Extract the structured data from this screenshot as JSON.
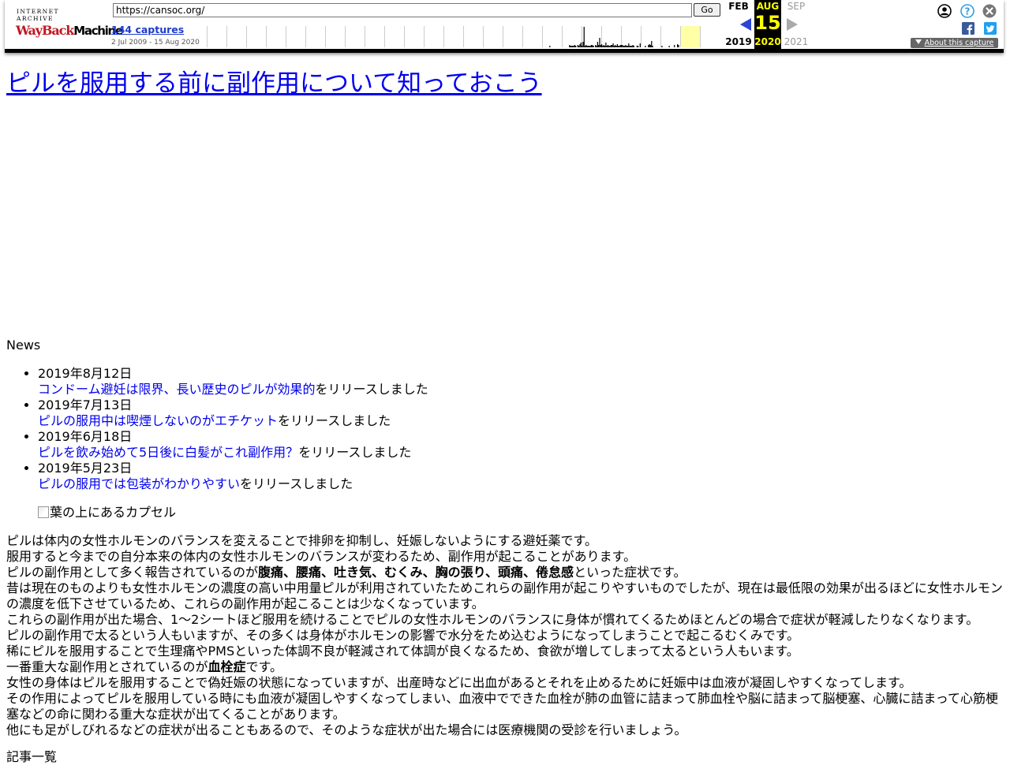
{
  "toolbar": {
    "logo_top": "INTERNET ARCHIVE",
    "logo_way": "WayBack",
    "logo_machine": "Machine",
    "url_value": "https://cansoc.org/",
    "go_label": "Go",
    "captures_label": "144 captures",
    "date_range": "2 Jul 2009 - 15 Aug 2020",
    "calendar": {
      "prev_month": "FEB",
      "prev_year": "2019",
      "current_month": "AUG",
      "current_day": "15",
      "current_year": "2020",
      "next_month": "SEP",
      "next_year": "2021"
    },
    "about_label": "About this capture",
    "sparkline": [
      0,
      0,
      0,
      0,
      0,
      0,
      0,
      0,
      0,
      0,
      0,
      0,
      0,
      0,
      0,
      0,
      0,
      0,
      0,
      0,
      0,
      0,
      0,
      0,
      0,
      0,
      0,
      0,
      0,
      0,
      0,
      0,
      0,
      0,
      0,
      0,
      0,
      0,
      0,
      0,
      0,
      0,
      0,
      0,
      0,
      0,
      0,
      0,
      0,
      0,
      0,
      0,
      0,
      0,
      0,
      0,
      0,
      0,
      0,
      0,
      0,
      0,
      0,
      0,
      0,
      0,
      0,
      0,
      0,
      0,
      0,
      0,
      0,
      0,
      0,
      0,
      0,
      0,
      0,
      0,
      0,
      0,
      0,
      0,
      0,
      0,
      0,
      0,
      0,
      0,
      0,
      0,
      0,
      0,
      0,
      0,
      0,
      0,
      0,
      0,
      0,
      0,
      0,
      0,
      0,
      0,
      0,
      0,
      0,
      0,
      0,
      0,
      0,
      0,
      0,
      0,
      0,
      0,
      0,
      0,
      0,
      0,
      0,
      0,
      0,
      0,
      0,
      0,
      0,
      0,
      0,
      0,
      0,
      0,
      0,
      0,
      0,
      0,
      0,
      0,
      0,
      0,
      0,
      0,
      0,
      0,
      0,
      0,
      0,
      0,
      0,
      0,
      0,
      0,
      0,
      0,
      0,
      0,
      0,
      0,
      0,
      0,
      0,
      0,
      0,
      0,
      0,
      0,
      0,
      0,
      0,
      0,
      0,
      0,
      0,
      0,
      0,
      0,
      0,
      0,
      0,
      0,
      0,
      0,
      0,
      0,
      0,
      0,
      0,
      0,
      0,
      0,
      0,
      0,
      0,
      0,
      0,
      0,
      0,
      0,
      0,
      0,
      0,
      0,
      0,
      0,
      0,
      0,
      0,
      0,
      0,
      0,
      0,
      0,
      0,
      0,
      0,
      0,
      0,
      0,
      0,
      0,
      0,
      0,
      0,
      0,
      0,
      0,
      0,
      0,
      0,
      0,
      0,
      0,
      0,
      0,
      0,
      0,
      0,
      0,
      0,
      0,
      0,
      0,
      0,
      0,
      0,
      0,
      0,
      0,
      0,
      0,
      0,
      0,
      0,
      0,
      0,
      0,
      0,
      0,
      0,
      0,
      0,
      0,
      0,
      0,
      0,
      0,
      0,
      0,
      0,
      0,
      0,
      0,
      0,
      0,
      0,
      0,
      0,
      0,
      0,
      0,
      0,
      0,
      0,
      0,
      0,
      0,
      0,
      0,
      0,
      0,
      0,
      0,
      0,
      0,
      0,
      0,
      0,
      0,
      0,
      0,
      0,
      0,
      0,
      0,
      0,
      0,
      0,
      0,
      0,
      0,
      0,
      0,
      0,
      0,
      0,
      0,
      0,
      0,
      0,
      0,
      0,
      0,
      0,
      0,
      0,
      0,
      0,
      0,
      2,
      0,
      0,
      0,
      0,
      0,
      0,
      0,
      0,
      0,
      0,
      0,
      0,
      0,
      0,
      0,
      0,
      0,
      0,
      3,
      2,
      2,
      2,
      2,
      3,
      2,
      0,
      3,
      2,
      4,
      6,
      2,
      7,
      26,
      2,
      3,
      2,
      2,
      2,
      2,
      3,
      3,
      2,
      0,
      3,
      2,
      7,
      3,
      12,
      3,
      4,
      2,
      3,
      2,
      6,
      2,
      3,
      2,
      2,
      3,
      3,
      5,
      2,
      3,
      2,
      4,
      2,
      2,
      3,
      3,
      3,
      2,
      2,
      3,
      2,
      2,
      5,
      2,
      2,
      2,
      3,
      2,
      0,
      0,
      2,
      2,
      0,
      5,
      0,
      0,
      0,
      0,
      2,
      0,
      0,
      3,
      4,
      3,
      8,
      2,
      0,
      0,
      0,
      0,
      0,
      0,
      0,
      0,
      2,
      0,
      0,
      0,
      0,
      0,
      0,
      2,
      0,
      0,
      0,
      0,
      3,
      0,
      0,
      4,
      3,
      0,
      0,
      0,
      0,
      0,
      0,
      0,
      0,
      0,
      0,
      0,
      0,
      0,
      0,
      0,
      0,
      0,
      0,
      0,
      0,
      0,
      0,
      0,
      0,
      0,
      0,
      0,
      0,
      0,
      0,
      0,
      0,
      0,
      0,
      0,
      0,
      0,
      0,
      0
    ],
    "highlight_year_index": 24
  },
  "site": {
    "title": "ピルを服用する前に副作用について知っておこう",
    "news_heading": "News",
    "news": [
      {
        "date": "2019年8月12日",
        "link": "コンドーム避妊は限界、長い歴史のピルが効果的",
        "suffix": "をリリースしました"
      },
      {
        "date": "2019年7月13日",
        "link": "ピルの服用中は喫煙しないのがエチケット",
        "suffix": "をリリースしました"
      },
      {
        "date": "2019年6月18日",
        "link": "ピルを飲み始めて5日後に白髪がこれ副作用？",
        "suffix": "をリリースしました"
      },
      {
        "date": "2019年5月23日",
        "link": "ピルの服用では包装がわかりやすい",
        "suffix": "をリリースしました"
      }
    ],
    "image_alt": "葉の上にあるカプセル",
    "intro": {
      "p1": "ピルは体内の女性ホルモンのバランスを変えることで排卵を抑制し、妊娠しないようにする避妊薬です。",
      "p2": "服用すると今までの自分本来の体内の女性ホルモンのバランスが変わるため、副作用が起こることがあります。",
      "p3_pre": "ピルの副作用として多く報告されているのが",
      "p3_bold": "腹痛、腰痛、吐き気、むくみ、胸の張り、頭痛、倦怠感",
      "p3_post": "といった症状です。",
      "p4": "昔は現在のものよりも女性ホルモンの濃度の高い中用量ピルが利用されていたためこれらの副作用が起こりやすいものでしたが、現在は最低限の効果が出るほどに女性ホルモンの濃度を低下させているため、これらの副作用が起こることは少なくなっています。",
      "p5": "これらの副作用が出た場合、1〜2シートほど服用を続けることでピルの女性ホルモンのバランスに身体が慣れてくるためほとんどの場合で症状が軽減したりなくなります。",
      "p6": "ピルの副作用で太るという人もいますが、その多くは身体がホルモンの影響で水分をため込むようになってしまうことで起こるむくみです。",
      "p7": "稀にピルを服用することで生理痛やPMSといった体調不良が軽減されて体調が良くなるため、食欲が増してしまって太るという人もいます。",
      "p8_pre": "一番重大な副作用とされているのが",
      "p8_bold": "血栓症",
      "p8_post": "です。",
      "p9": "女性の身体はピルを服用することで偽妊娠の状態になっていますが、出産時などに出血があるとそれを止めるために妊娠中は血液が凝固しやすくなってします。",
      "p10": "その作用によってピルを服用している時にも血液が凝固しやすくなってしまい、血液中でできた血栓が肺の血管に詰まって肺血栓や脳に詰まって脳梗塞、心臓に詰まって心筋梗塞などの命に関わる重大な症状が出てくることがあります。",
      "p11": "他にも足がしびれるなどの症状が出ることもあるので、そのような症状が出た場合には医療機関の受診を行いましょう。"
    },
    "list_heading": "記事一覧"
  }
}
